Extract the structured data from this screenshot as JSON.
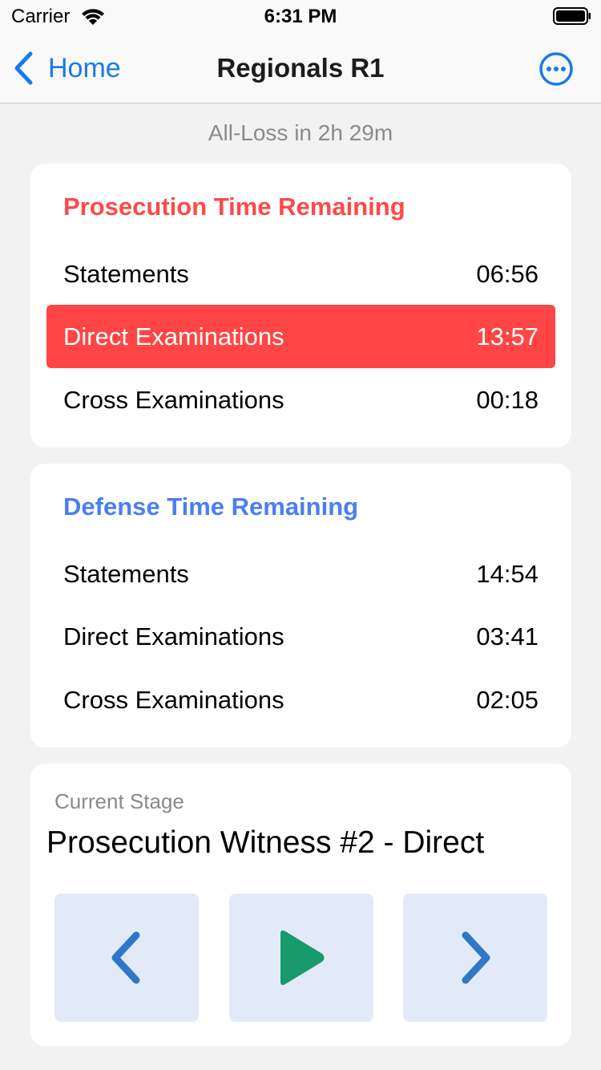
{
  "status_bar": {
    "carrier": "Carrier",
    "time": "6:31 PM"
  },
  "nav": {
    "back_label": "Home",
    "title": "Regionals R1"
  },
  "all_loss": "All-Loss in 2h 29m",
  "prosecution": {
    "title": "Prosecution Time Remaining",
    "color": "#ff4848",
    "rows": [
      {
        "label": "Statements",
        "value": "06:56"
      },
      {
        "label": "Direct Examinations",
        "value": "13:57",
        "active": true
      },
      {
        "label": "Cross Examinations",
        "value": "00:18"
      }
    ]
  },
  "defense": {
    "title": "Defense Time Remaining",
    "color": "#4a7ef2",
    "rows": [
      {
        "label": "Statements",
        "value": "14:54"
      },
      {
        "label": "Direct Examinations",
        "value": "03:41"
      },
      {
        "label": "Cross Examinations",
        "value": "02:05"
      }
    ]
  },
  "stage": {
    "label": "Current Stage",
    "value": "Prosecution Witness #2 - Direct"
  },
  "controls": {
    "previous_icon": "chevron-left-icon",
    "play_icon": "play-icon",
    "next_icon": "chevron-right-icon",
    "chevron_color": "#2f78c8",
    "play_color": "#189a6c"
  },
  "icons": {
    "more": "ellipsis-circle-icon",
    "back": "chevron-left-icon"
  }
}
